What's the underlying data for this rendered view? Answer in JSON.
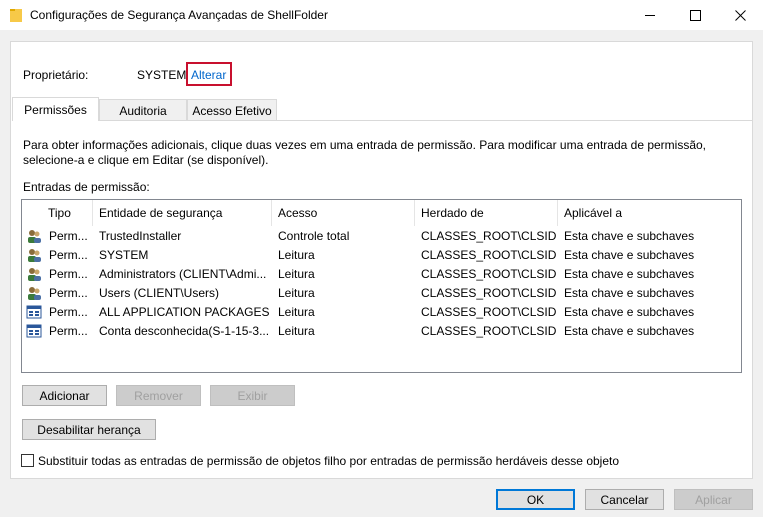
{
  "window": {
    "title": "Configurações de Segurança Avançadas de ShellFolder",
    "minimize_glyph": "—",
    "maximize_glyph": "☐",
    "close_glyph": "✕"
  },
  "owner": {
    "label": "Proprietário:",
    "value": "SYSTEM",
    "change_link": "Alterar"
  },
  "tabs": [
    {
      "label": "Permissões",
      "active": true
    },
    {
      "label": "Auditoria",
      "active": false
    },
    {
      "label": "Acesso Efetivo",
      "active": false
    }
  ],
  "info_text_line1": "Para obter informações adicionais, clique duas vezes em uma entrada de permissão. Para modificar uma entrada de permissão,",
  "info_text_line2": "selecione-a e clique em Editar (se disponível).",
  "entries_label": "Entradas de permissão:",
  "table": {
    "columns": [
      "Tipo",
      "Entidade de segurança",
      "Acesso",
      "Herdado de",
      "Aplicável a"
    ],
    "rows": [
      {
        "icon": "users-icon",
        "type": "Perm...",
        "principal": "TrustedInstaller",
        "access": "Controle total",
        "inherited": "CLASSES_ROOT\\CLSID...",
        "applies": "Esta chave e subchaves"
      },
      {
        "icon": "users-icon",
        "type": "Perm...",
        "principal": "SYSTEM",
        "access": "Leitura",
        "inherited": "CLASSES_ROOT\\CLSID...",
        "applies": "Esta chave e subchaves"
      },
      {
        "icon": "users-icon",
        "type": "Perm...",
        "principal": "Administrators (CLIENT\\Admi...",
        "access": "Leitura",
        "inherited": "CLASSES_ROOT\\CLSID...",
        "applies": "Esta chave e subchaves"
      },
      {
        "icon": "users-icon",
        "type": "Perm...",
        "principal": "Users (CLIENT\\Users)",
        "access": "Leitura",
        "inherited": "CLASSES_ROOT\\CLSID...",
        "applies": "Esta chave e subchaves"
      },
      {
        "icon": "app-package-icon",
        "type": "Perm...",
        "principal": "ALL APPLICATION PACKAGES",
        "access": "Leitura",
        "inherited": "CLASSES_ROOT\\CLSID...",
        "applies": "Esta chave e subchaves"
      },
      {
        "icon": "app-package-icon",
        "type": "Perm...",
        "principal": "Conta desconhecida(S-1-15-3...",
        "access": "Leitura",
        "inherited": "CLASSES_ROOT\\CLSID...",
        "applies": "Esta chave e subchaves"
      }
    ]
  },
  "buttons": {
    "add": "Adicionar",
    "remove": "Remover",
    "view": "Exibir",
    "disable_inheritance": "Desabilitar herança",
    "ok": "OK",
    "cancel": "Cancelar",
    "apply": "Aplicar"
  },
  "replace_checkbox_label": "Substituir todas as entradas de permissão de objetos filho por entradas de permissão herdáveis desse objeto",
  "colors": {
    "link": "#0066cc",
    "highlight_box": "#c8102e",
    "primary_border": "#0078d7"
  }
}
